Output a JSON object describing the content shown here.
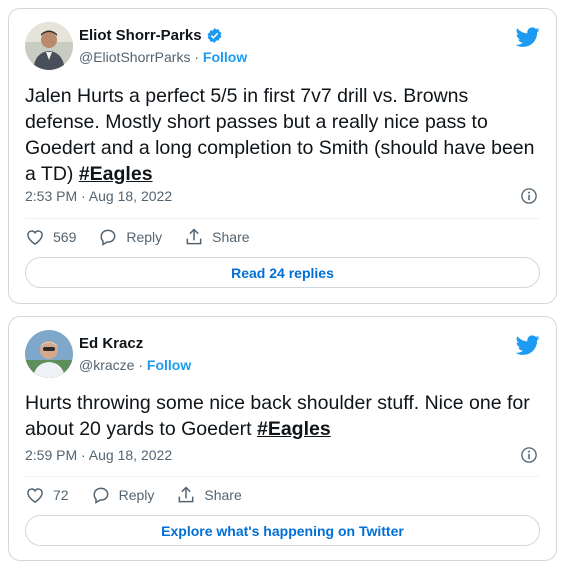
{
  "tweets": [
    {
      "author_name": "Eliot Shorr-Parks",
      "handle": "@EliotShorrParks",
      "separator": "·",
      "follow_label": "Follow",
      "text_main": "Jalen Hurts a perfect 5/5 in first 7v7 drill vs. Browns defense. Mostly short passes but a really nice pass to Goedert and a long completion to Smith (should have been a TD) ",
      "hashtag": "#Eagles",
      "timestamp": "2:53 PM · Aug 18, 2022",
      "likes": "569",
      "reply_label": "Reply",
      "share_label": "Share",
      "button_label": "Read 24 replies",
      "verified": true
    },
    {
      "author_name": "Ed Kracz",
      "handle": "@kracze",
      "separator": "·",
      "follow_label": "Follow",
      "text_main": "Hurts throwing some nice back shoulder stuff. Nice one for about 20 yards to Goedert ",
      "hashtag": "#Eagles",
      "timestamp": "2:59 PM · Aug 18, 2022",
      "likes": "72",
      "reply_label": "Reply",
      "share_label": "Share",
      "button_label": "Explore what's happening on Twitter",
      "verified": false
    }
  ],
  "icons": [
    "twitter-bird-icon",
    "verified-badge-icon",
    "info-icon",
    "heart-icon",
    "reply-icon",
    "share-icon"
  ],
  "colors": {
    "accent": "#1d9bf0",
    "button_text": "#006fd6",
    "muted": "#536471",
    "border": "#cfd9de"
  }
}
